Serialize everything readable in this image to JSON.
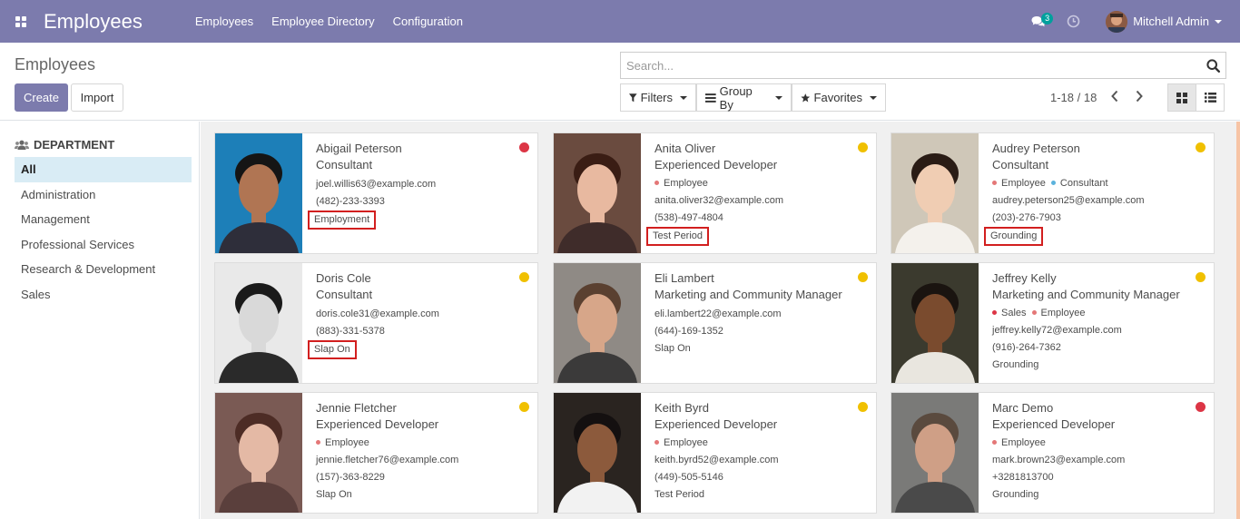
{
  "navbar": {
    "app_title": "Employees",
    "menu": [
      "Employees",
      "Employee Directory",
      "Configuration"
    ],
    "chat_count": "3",
    "user_name": "Mitchell Admin"
  },
  "control_panel": {
    "breadcrumb": "Employees",
    "create_label": "Create",
    "import_label": "Import",
    "search_placeholder": "Search...",
    "filters_label": "Filters",
    "group_by_label": "Group By",
    "favorites_label": "Favorites",
    "pager": "1-18 / 18"
  },
  "sidebar": {
    "title": "DEPARTMENT",
    "items": [
      "All",
      "Administration",
      "Management",
      "Professional Services",
      "Research & Development",
      "Sales"
    ],
    "active": "All"
  },
  "colors": {
    "navbar": "#7c7bad",
    "status_red": "#dc3545",
    "status_yellow": "#f0c000",
    "tag_employee": "#e47777",
    "tag_consultant": "#5bb2dc",
    "highlight_box": "#d21f1f"
  },
  "employees": [
    {
      "name": "Abigail Peterson",
      "job": "Consultant",
      "tags": [],
      "email": "joel.willis63@example.com",
      "phone": "(482)-233-3393",
      "plan": "Employment",
      "status": "red",
      "highlighted": true
    },
    {
      "name": "Anita Oliver",
      "job": "Experienced Developer",
      "tags": [
        "Employee"
      ],
      "email": "anita.oliver32@example.com",
      "phone": "(538)-497-4804",
      "plan": "Test Period",
      "status": "yellow",
      "highlighted": true
    },
    {
      "name": "Audrey Peterson",
      "job": "Consultant",
      "tags": [
        "Employee",
        "Consultant"
      ],
      "email": "audrey.peterson25@example.com",
      "phone": "(203)-276-7903",
      "plan": "Grounding",
      "status": "yellow",
      "highlighted": true
    },
    {
      "name": "Doris Cole",
      "job": "Consultant",
      "tags": [],
      "email": "doris.cole31@example.com",
      "phone": "(883)-331-5378",
      "plan": "Slap On",
      "status": "yellow",
      "highlighted": true
    },
    {
      "name": "Eli Lambert",
      "job": "Marketing and Community Manager",
      "tags": [],
      "email": "eli.lambert22@example.com",
      "phone": "(644)-169-1352",
      "plan": "Slap On",
      "status": "yellow",
      "highlighted": false
    },
    {
      "name": "Jeffrey Kelly",
      "job": "Marketing and Community Manager",
      "tags": [
        "Sales",
        "Employee"
      ],
      "email": "jeffrey.kelly72@example.com",
      "phone": "(916)-264-7362",
      "plan": "Grounding",
      "status": "yellow",
      "highlighted": false
    },
    {
      "name": "Jennie Fletcher",
      "job": "Experienced Developer",
      "tags": [
        "Employee"
      ],
      "email": "jennie.fletcher76@example.com",
      "phone": "(157)-363-8229",
      "plan": "Slap On",
      "status": "yellow",
      "highlighted": false
    },
    {
      "name": "Keith Byrd",
      "job": "Experienced Developer",
      "tags": [
        "Employee"
      ],
      "email": "keith.byrd52@example.com",
      "phone": "(449)-505-5146",
      "plan": "Test Period",
      "status": "yellow",
      "highlighted": false
    },
    {
      "name": "Marc Demo",
      "job": "Experienced Developer",
      "tags": [
        "Employee"
      ],
      "email": "mark.brown23@example.com",
      "phone": "+3281813700",
      "plan": "Grounding",
      "status": "red",
      "highlighted": false
    }
  ]
}
